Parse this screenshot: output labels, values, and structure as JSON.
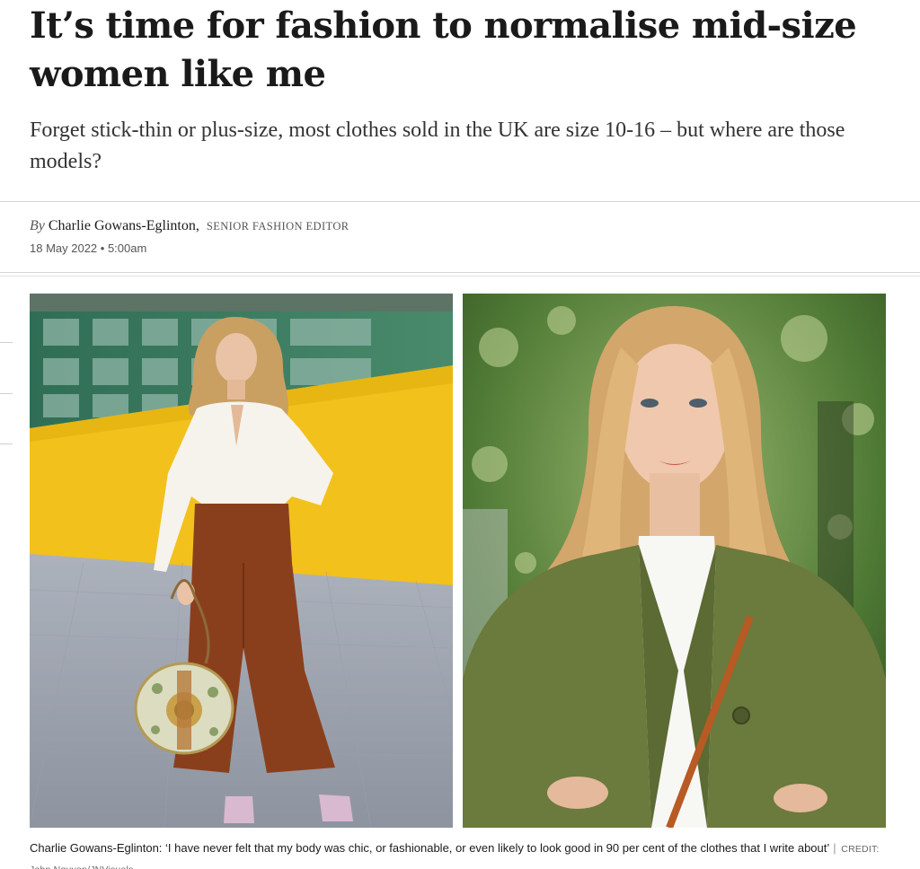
{
  "article": {
    "headline": "It’s time for fashion to normalise mid-size women like me",
    "standfirst": "Forget stick-thin or plus-size, most clothes sold in the UK are size 10-16 – but where are those models?",
    "byline": {
      "prefix": "By",
      "author": "Charlie Gowans-Eglinton,",
      "role": "SENIOR FASHION EDITOR"
    },
    "date": "18 May 2022 • 5:00am"
  },
  "image": {
    "caption": "Charlie Gowans-Eglinton: ‘I have never felt that my body was chic, or fashionable, or even likely to look good in 90 per cent of the clothes that I write about’",
    "credit": "CREDIT: John Nguyen/JNVisuals"
  },
  "colors": {
    "text": "#1a1a1a",
    "muted": "#555555",
    "rule": "#d6d6d6",
    "background": "#ffffff"
  }
}
